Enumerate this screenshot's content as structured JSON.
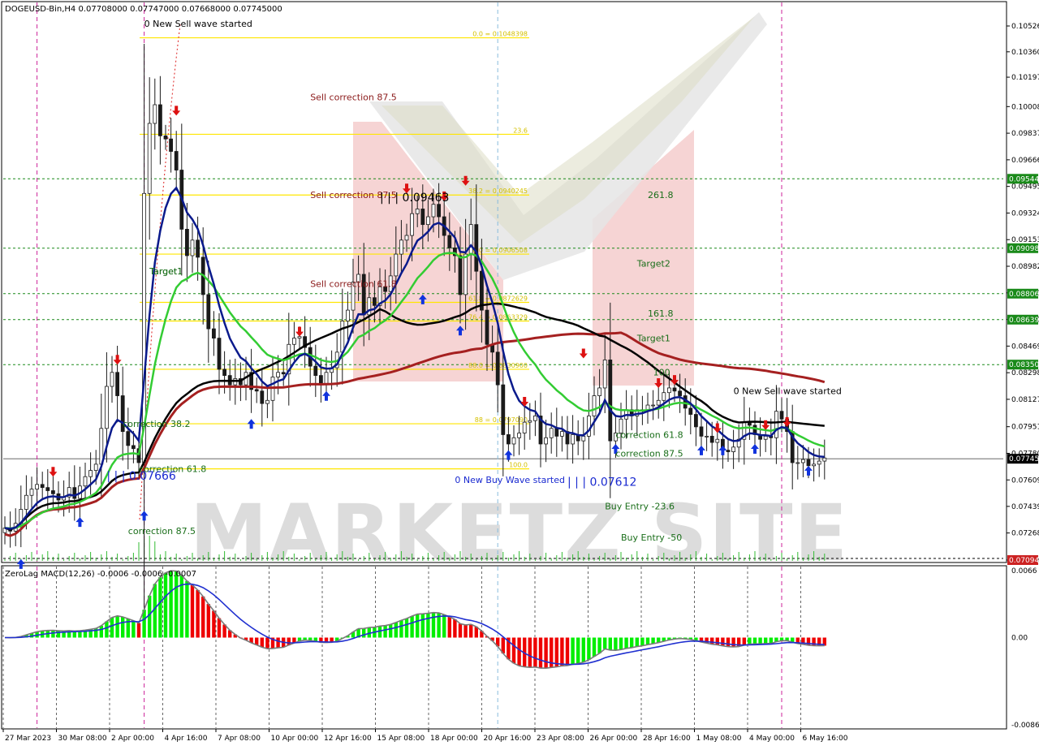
{
  "window": {
    "symbol_info": "DOGEUSD-Bin,H4  0.07708000 0.07747000 0.07668000 0.07745000",
    "macd_label": "ZeroLag MACD(12,26) -0.0006 -0.0006 -0.0007",
    "watermark": "MARKETZ SITE"
  },
  "colors": {
    "background": "#ffffff",
    "candle": "#1a1a1a",
    "ma_blue": "#0a1a8c",
    "ma_green": "#33cc33",
    "ma_black": "#000000",
    "ma_red": "#a52020",
    "fib_line": "#ffe600",
    "green_dash": "#1a8a1a",
    "magenta_dash": "#cc2299",
    "hist_green": "#00ee00",
    "hist_red": "#ee0000",
    "signal_gray": "#7a7a7a",
    "signal_blue": "#2030d0",
    "current_price_bg": "#000000",
    "low_price_bg": "#cc2222",
    "target_bg": "#1a8a1a"
  },
  "chart_data": [
    {
      "type": "candlestick",
      "title": "DOGEUSD-Bin,H4",
      "ohlc_shown": {
        "open": 0.07708,
        "high": 0.07747,
        "low": 0.07668,
        "close": 0.07745
      },
      "ylim": [
        0.07094,
        0.10526
      ],
      "y_tick_labels": [
        "0.10526",
        "0.10360",
        "0.10197",
        "0.10008",
        "0.09837",
        "0.09666",
        "0.09495",
        "0.09324",
        "0.09153",
        "0.08982",
        "0.08811",
        "0.08640",
        "0.08469",
        "0.08298",
        "0.08127",
        "0.07951",
        "0.07780",
        "0.07609",
        "0.07439",
        "0.07268",
        "0.07094"
      ],
      "x_tick_labels": [
        "27 Mar 2023",
        "30 Mar 08:00",
        "2 Apr 00:00",
        "4 Apr 16:00",
        "7 Apr 08:00",
        "10 Apr 00:00",
        "12 Apr 16:00",
        "15 Apr 08:00",
        "18 Apr 00:00",
        "20 Apr 16:00",
        "23 Apr 08:00",
        "26 Apr 00:00",
        "28 Apr 16:00",
        "1 May 08:00",
        "4 May 00:00",
        "6 May 16:00"
      ],
      "price_badges": [
        {
          "label": "0.09544",
          "kind": "target"
        },
        {
          "label": "0.09098",
          "kind": "target"
        },
        {
          "label": "0.08806",
          "kind": "target"
        },
        {
          "label": "0.08639",
          "kind": "target"
        },
        {
          "label": "0.08350",
          "kind": "target"
        },
        {
          "label": "0.07745",
          "kind": "current"
        },
        {
          "label": "0.07094",
          "kind": "low"
        }
      ],
      "green_levels": [
        0.09544,
        0.09098,
        0.08806,
        0.08639,
        0.0835
      ],
      "fib_levels": [
        {
          "price": 0.1045,
          "label": "0.0 = 0.1048398",
          "x0": 0.0797
        },
        {
          "price": 0.0983,
          "label": "23.6",
          "x0": 0.0797
        },
        {
          "price": 0.0944,
          "label": "38.2 = 0.0940245",
          "x0": 0.0797
        },
        {
          "price": 0.0906,
          "label": "50.0 = 0.0906508",
          "x0": 0.0797
        },
        {
          "price": 0.0875,
          "label": "61.8 = 0.0872629",
          "x0": 0.0797
        },
        {
          "price": 0.0863,
          "label": "76.4 = 0.0863329",
          "x0": 0.0797
        },
        {
          "price": 0.0832,
          "label": "88.0 = 0.0830900",
          "x0": 0.0797
        },
        {
          "price": 0.0797,
          "label": "88 = 0.0797090",
          "x0": 0.0797
        },
        {
          "price": 0.0768,
          "label": "100.0",
          "x0": 0.0797
        }
      ],
      "chart_annotations": [
        {
          "text": "0 New Sell wave started",
          "price": 0.1052,
          "bar": 26,
          "color": "#000000"
        },
        {
          "text": "Sell correction 87.5",
          "price": 0.1005,
          "bar": 57,
          "color": "#8b1a1a"
        },
        {
          "text": "Sell correction 87.5",
          "price": 0.0942,
          "bar": 57,
          "color": "#8b1a1a"
        },
        {
          "text": "Sell correction 61.8",
          "price": 0.0885,
          "bar": 57,
          "color": "#8b1a1a"
        },
        {
          "text": "| | | 0.09463",
          "price": 0.094,
          "bar": 70,
          "color": "#000000",
          "big": true
        },
        {
          "text": "Target1",
          "price": 0.0893,
          "bar": 27,
          "color": "#1a6e1a"
        },
        {
          "text": "261.8",
          "price": 0.0942,
          "bar": 120,
          "color": "#1a6e1a"
        },
        {
          "text": "Target2",
          "price": 0.0898,
          "bar": 118,
          "color": "#1a6e1a"
        },
        {
          "text": "161.8",
          "price": 0.0866,
          "bar": 120,
          "color": "#1a6e1a"
        },
        {
          "text": "Target1",
          "price": 0.085,
          "bar": 118,
          "color": "#1a6e1a"
        },
        {
          "text": "100",
          "price": 0.0828,
          "bar": 121,
          "color": "#1a6e1a"
        },
        {
          "text": "0 New Sell wave started",
          "price": 0.0816,
          "bar": 136,
          "color": "#000000"
        },
        {
          "text": "correction 38.2",
          "price": 0.0795,
          "bar": 22,
          "color": "#1a6e1a"
        },
        {
          "text": "correction 61.8",
          "price": 0.0788,
          "bar": 114,
          "color": "#1a6e1a"
        },
        {
          "text": "correction 87.5",
          "price": 0.0776,
          "bar": 114,
          "color": "#1a6e1a"
        },
        {
          "text": "correction 61.8",
          "price": 0.0766,
          "bar": 25,
          "color": "#1a6e1a"
        },
        {
          "text": "| | | 0.07666",
          "price": 0.0761,
          "bar": 19,
          "color": "#1a2ad0",
          "big": true
        },
        {
          "text": "0 New Buy Wave started",
          "price": 0.0759,
          "bar": 84,
          "color": "#1a2ad0"
        },
        {
          "text": "| | | 0.07612",
          "price": 0.0757,
          "bar": 105,
          "color": "#1a2ad0",
          "big": true
        },
        {
          "text": "Buy Entry -23.6",
          "price": 0.0742,
          "bar": 112,
          "color": "#1a6e1a"
        },
        {
          "text": "Buy Entry -50",
          "price": 0.0722,
          "bar": 115,
          "color": "#1a6e1a"
        },
        {
          "text": "correction 87.5",
          "price": 0.0726,
          "bar": 23,
          "color": "#1a6e1a"
        },
        {
          "text": "Target1",
          "price": 0.0893,
          "bar": 27,
          "color": "#1a6e1a"
        }
      ],
      "vertical_markers": [
        {
          "bar": 6,
          "style": "magenta"
        },
        {
          "bar": 26,
          "style": "magenta"
        },
        {
          "bar": 92,
          "style": "cyan"
        },
        {
          "bar": 145,
          "style": "magenta"
        }
      ],
      "candles_close": [
        0.073,
        0.0728,
        0.0733,
        0.0742,
        0.0751,
        0.0755,
        0.0758,
        0.0756,
        0.0754,
        0.0752,
        0.0748,
        0.075,
        0.0756,
        0.0749,
        0.0757,
        0.0763,
        0.0767,
        0.0771,
        0.0794,
        0.0821,
        0.083,
        0.0815,
        0.0792,
        0.0783,
        0.0781,
        0.0772,
        0.0945,
        0.099,
        0.1002,
        0.0982,
        0.098,
        0.0972,
        0.096,
        0.0922,
        0.0905,
        0.0915,
        0.0904,
        0.088,
        0.0858,
        0.0852,
        0.0832,
        0.0828,
        0.0822,
        0.0826,
        0.0822,
        0.083,
        0.0819,
        0.0818,
        0.081,
        0.0812,
        0.0827,
        0.083,
        0.0829,
        0.0848,
        0.0852,
        0.0853,
        0.0846,
        0.0834,
        0.0828,
        0.0822,
        0.083,
        0.0833,
        0.0843,
        0.0863,
        0.087,
        0.0888,
        0.0893,
        0.0867,
        0.0878,
        0.0873,
        0.0885,
        0.0882,
        0.0892,
        0.0906,
        0.0915,
        0.0918,
        0.0932,
        0.0935,
        0.0925,
        0.093,
        0.0938,
        0.093,
        0.0918,
        0.091,
        0.0905,
        0.088,
        0.0906,
        0.0925,
        0.0895,
        0.087,
        0.0848,
        0.0843,
        0.0822,
        0.079,
        0.0784,
        0.0788,
        0.0791,
        0.0798,
        0.0799,
        0.0802,
        0.0784,
        0.0788,
        0.0794,
        0.0789,
        0.0792,
        0.0784,
        0.079,
        0.0786,
        0.0789,
        0.0802,
        0.0815,
        0.082,
        0.0838,
        0.0786,
        0.0791,
        0.08,
        0.0806,
        0.0802,
        0.0806,
        0.0805,
        0.0809,
        0.0809,
        0.0812,
        0.0817,
        0.082,
        0.0818,
        0.0815,
        0.0807,
        0.0803,
        0.0795,
        0.0789,
        0.0789,
        0.0785,
        0.0787,
        0.078,
        0.0779,
        0.0782,
        0.0787,
        0.0798,
        0.0796,
        0.079,
        0.0787,
        0.0789,
        0.0788,
        0.0805,
        0.08,
        0.0792,
        0.0772,
        0.0772,
        0.0774,
        0.077,
        0.0771,
        0.0773,
        0.0775
      ]
    },
    {
      "type": "macd_histogram",
      "title": "ZeroLag MACD(12,26)",
      "values_shown": [
        -0.0006,
        -0.0006,
        -0.0007
      ],
      "ylim": [
        -0.0086,
        0.0066
      ],
      "y_tick_labels": [
        "0.0066",
        "0.00",
        "-0.0086"
      ]
    }
  ]
}
